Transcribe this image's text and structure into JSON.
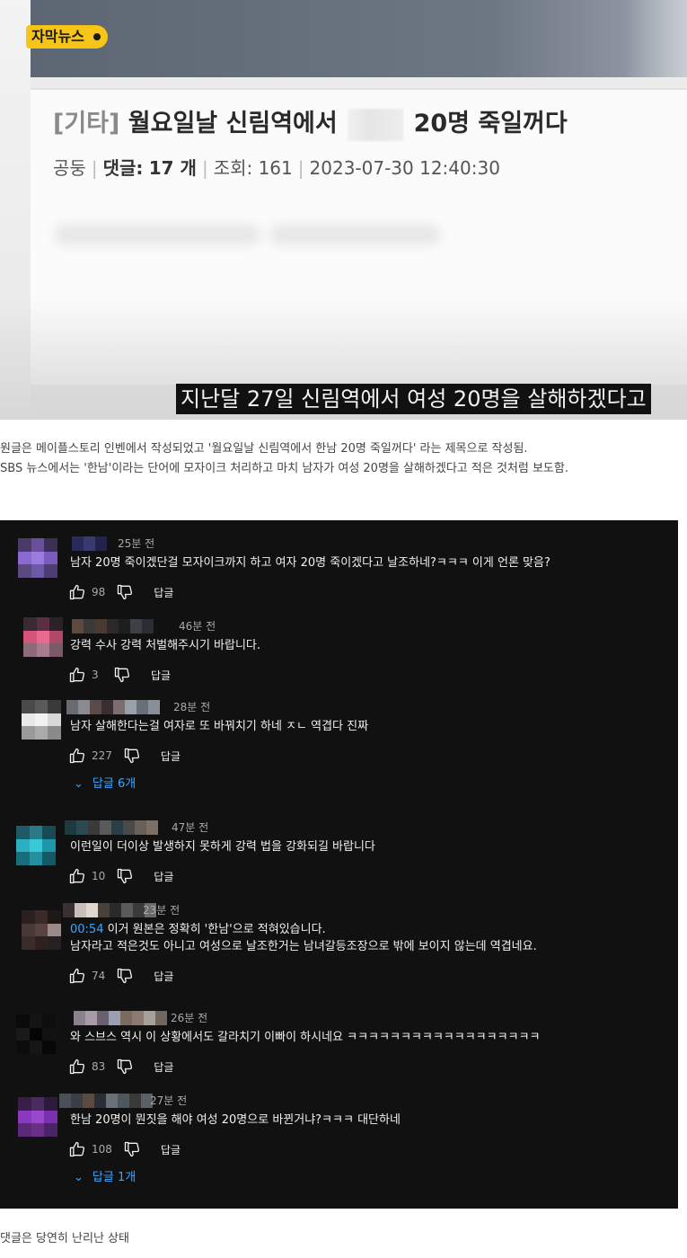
{
  "video": {
    "badge": "자막뉴스",
    "post": {
      "category": "[기타]",
      "title_part1": "월요일날 신림역에서",
      "title_part2": "20명 죽일꺼다",
      "author": "공둥",
      "comments_label": "댓글:",
      "comments_count": "17 개",
      "views": "조회: 161",
      "datetime": "2023-07-30 12:40:30"
    },
    "subtitle": "지난달 27일 신림역에서 여성 20명을 살해하겠다고"
  },
  "caption": {
    "line1": "원글은 메이플스토리 인벤에서 작성되었고 '월요일날 신림역에서 한남 20명 죽일꺼다' 라는 제목으로 작성됨.",
    "line2": "SBS 뉴스에서는 '한남'이라는 단어에 모자이크 처리하고 마치 남자가 여성 20명을 살해하겠다고 적은 것처럼 보도함."
  },
  "comments": [
    {
      "time": "25분 전",
      "lines": [
        "남자 20명 죽이겠단걸 모자이크까지 하고 여자 20명 죽이겠다고 날조하네?ㅋㅋㅋ 이게 언론 맞음?"
      ],
      "likes": "98",
      "reply_label": "답글",
      "avatar_colors": [
        "#4a3a6a",
        "#6b4f9a",
        "#3c2f55",
        "#8a6ad0",
        "#9b7be0",
        "#7a5cc0",
        "#5a4a80",
        "#6e58a8",
        "#4d3e72"
      ],
      "name_colors": [
        "#2a2a58",
        "#3a3a70",
        "#23234a"
      ]
    },
    {
      "time": "46분 전",
      "lines": [
        "강력 수사 강력 처벌해주시기 바랍니다."
      ],
      "likes": "3",
      "reply_label": "답글",
      "avatar_colors": [
        "#3a2a33",
        "#5a3040",
        "#2a2228",
        "#d4547a",
        "#e86a92",
        "#b04868",
        "#8c6c78",
        "#a87c8c",
        "#7a5a66"
      ],
      "name_colors": [
        "#5a4a40",
        "#3a3a3a",
        "#4a3a30",
        "#2a2a2a",
        "#1e1e1e",
        "#3c4048",
        "#2a2e34"
      ]
    },
    {
      "time": "28분 전",
      "lines": [
        "남자 살해한다는걸 여자로 또 바꿔치기 하네 ㅈㄴ 역겹다 진짜"
      ],
      "likes": "227",
      "reply_label": "답글",
      "replies": "답글 6개",
      "avatar_colors": [
        "#4a4a4a",
        "#5a5a5a",
        "#3a3a3a",
        "#e8e8e8",
        "#f2f2f2",
        "#d8d8d8",
        "#9a9a9a",
        "#aaaaaa",
        "#8a8a8a"
      ],
      "name_colors": [
        "#6a6a72",
        "#8a8a92",
        "#5a4a48",
        "#3a2e30",
        "#7a6e70",
        "#9aa0a8",
        "#6a6e78",
        "#8a8e96"
      ]
    },
    {
      "time": "47분 전",
      "lines": [
        "이런일이 더이상 발생하지 못하게 강력 법을 강화되길 바랍니다"
      ],
      "likes": "10",
      "reply_label": "답글",
      "avatar_colors": [
        "#1e5a66",
        "#2a7a88",
        "#164a55",
        "#2ab0c0",
        "#38c8d8",
        "#1e98a8",
        "#186e7a",
        "#2290a0",
        "#145a66"
      ],
      "name_colors": [
        "#1e3a40",
        "#2a4a50",
        "#3a3a3a",
        "#5a5a5a",
        "#2a3e46",
        "#4a4a4a",
        "#6a6058",
        "#7a7068"
      ]
    },
    {
      "time": "23분 전",
      "lines": [
        "00:54 이거 원본은 정확히 '한남'으로 적혀있습니다.",
        "남자라고 적은것도 아니고 여성으로 날조한거는 남녀갈등조장으로 밖에 보이지 않는데 역겹네요."
      ],
      "timestamp": "00:54",
      "likes": "74",
      "reply_label": "답글",
      "avatar_colors": [
        "#2a2020",
        "#3a2a28",
        "#1e1818",
        "#4a3836",
        "#5a4240",
        "#9a8a88",
        "#3a2c2a",
        "#2e2220",
        "#262020"
      ],
      "name_colors": [
        "#3a3030",
        "#c8c0b8",
        "#e0d8d0",
        "#4a4038",
        "#2a2a2a",
        "#5a5a5a",
        "#3a3a3a",
        "#6a6a6a"
      ]
    },
    {
      "time": "26분 전",
      "lines": [
        "와 스브스 역시 이 상황에서도 갈라치기 이빠이 하시네요 ㅋㅋㅋㅋㅋㅋㅋㅋㅋㅋㅋㅋㅋㅋㅋㅋㅋㅋ"
      ],
      "likes": "83",
      "reply_label": "답글",
      "avatar_colors": [
        "#0a0a0a",
        "#141414",
        "#0e0e0e",
        "#1a1a1a",
        "#050505",
        "#121212",
        "#0c0c0c",
        "#161616",
        "#080808"
      ],
      "name_colors": [
        "#8a8090",
        "#a89aa8",
        "#6a6070",
        "#9aa0b0",
        "#7a6a60",
        "#8a7a70",
        "#a8a098",
        "#706860"
      ]
    },
    {
      "time": "27분 전",
      "lines": [
        "한남 20명이 뭔짓을 해야 여성 20명으로 바뀐거냐?ㅋㅋㅋ 대단하네"
      ],
      "likes": "108",
      "reply_label": "답글",
      "replies": "답글 1개",
      "avatar_colors": [
        "#3a1e4a",
        "#4a2a60",
        "#2e1a3a",
        "#8a3ac0",
        "#9a48d0",
        "#7a30b0",
        "#5a2a78",
        "#6a3088",
        "#4a2468"
      ],
      "name_colors": [
        "#4a5058",
        "#3a3e46",
        "#5a4a40",
        "#2a2e36",
        "#6a7078",
        "#4e5660",
        "#3a3a3a",
        "#5a6068"
      ]
    }
  ],
  "footer": "댓글은 당연히 난리난 상태",
  "colors": {
    "panel_bg": "#111111",
    "link_blue": "#3ea6ff",
    "badge_yellow": "#f6c518"
  }
}
